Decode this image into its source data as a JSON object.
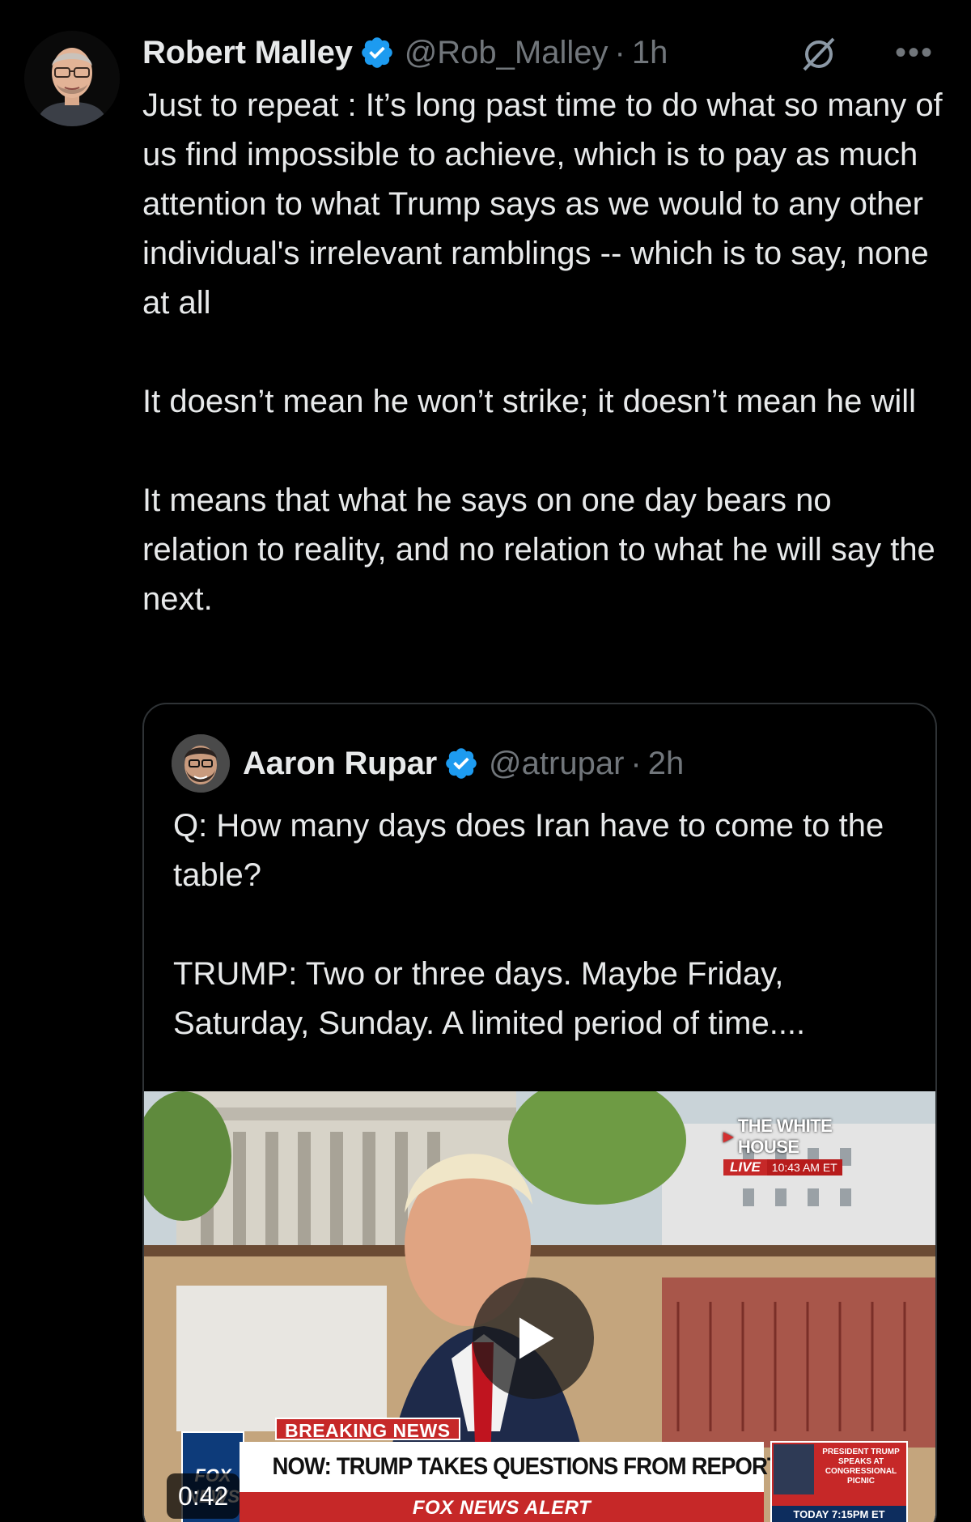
{
  "tweet": {
    "author_name": "Robert Malley",
    "handle": "@Rob_Malley",
    "separator": "·",
    "time": "1h",
    "more_label": "•••",
    "paragraphs": [
      "Just to repeat : It’s long past time to do what so many of us find impossible to achieve, which is to pay as much attention to what Trump says as we would to any other individual's irrelevant ramblings -- which is to say, none at all",
      "It doesn’t mean he won’t strike; it doesn’t mean he will",
      "It means that what he says on one day bears no relation to reality, and no relation to what he will say the next."
    ]
  },
  "quoted": {
    "author_name": "Aaron Rupar",
    "handle": "@atrupar",
    "separator": "·",
    "time": "2h",
    "paragraphs": [
      "Q: How many days does Iran have to come to the table?",
      "TRUMP: Two or three days. Maybe Friday, Saturday, Sunday. A limited period of time...."
    ],
    "video": {
      "duration": "0:42",
      "live_bug": {
        "title": "THE WHITE HOUSE",
        "live": "LIVE",
        "clock": "10:43 AM ET"
      },
      "breaking": "BREAKING NEWS",
      "headline": "NOW: TRUMP TAKES QUESTIONS FROM REPORTERS",
      "alert": "FOX NEWS ALERT",
      "side_box": {
        "text": "PRESIDENT TRUMP SPEAKS AT CONGRESSIONAL PICNIC",
        "time": "TODAY 7:15PM ET"
      },
      "logo": "FOX NEWS"
    }
  },
  "colors": {
    "background": "#000000",
    "text": "#e7e9ea",
    "secondary_text": "#71767b",
    "verified": "#1d9bf0",
    "border": "#2f3336",
    "fox_red": "#c62828"
  },
  "icons": [
    "verified-badge-icon",
    "grok-icon",
    "more-icon",
    "play-icon"
  ]
}
